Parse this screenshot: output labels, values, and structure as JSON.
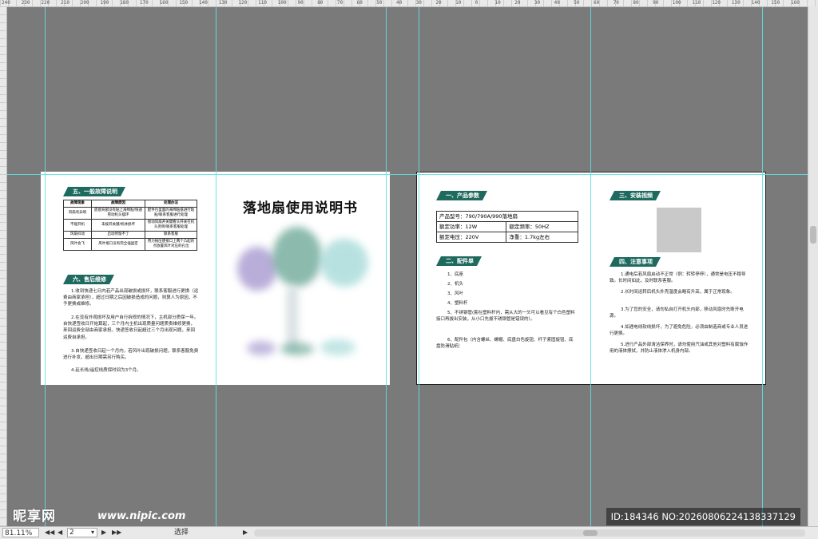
{
  "ruler": {
    "top_labels": [
      "240",
      "230",
      "220",
      "210",
      "200",
      "190",
      "180",
      "170",
      "160",
      "150",
      "140",
      "130",
      "120",
      "110",
      "100",
      "90",
      "80",
      "70",
      "60",
      "50",
      "40",
      "30",
      "20",
      "10",
      "0",
      "10",
      "20",
      "30",
      "40",
      "50",
      "60",
      "70",
      "80",
      "90",
      "100",
      "110",
      "120",
      "130",
      "140",
      "150",
      "160",
      "170",
      "180",
      "190",
      "200",
      "210",
      "220",
      "230",
      "240",
      "250",
      "260",
      "270",
      "280",
      "290",
      "300",
      "310",
      "320",
      "330",
      "340",
      "350",
      "360",
      "370",
      "380",
      "390",
      "400",
      "410",
      "420",
      "430",
      "440",
      "450"
    ]
  },
  "status": {
    "zoom": "81.11%",
    "page": "2",
    "tool": "选择"
  },
  "left_page": {
    "sec5_title": "五、一般故障说明",
    "fault_table": {
      "headers": [
        "故障现象",
        "故障原因",
        "处理办法"
      ],
      "rows": [
        [
          "风扇有异响",
          "底盘背部没有贴上海绵贴/快速晃动机头摆环",
          "配件包里面的海绵贴纸进行粘贴/联系客服进行处理"
        ],
        [
          "不能开机",
          "未按开关键/机体损坏",
          "接动风扇开关键看头开关在机头旁侧/联系客服处理"
        ],
        [
          "风扇抖动",
          "启动停留不了",
          "联系客服"
        ],
        [
          "风叶会飞",
          "风叶接口没有完全插固定",
          "用力按压使接口上两个凸起的点放置风叶对应的孔位"
        ]
      ]
    },
    "sec6_title": "六、售后维修",
    "sec6_paragraphs": [
      "1.收到快递七日内若产品出现破损或损坏，联系客服进行更换（运费由商家承担），超过日期之后因破损造成的问题，则算人为原因，不予更换或维修。",
      "2.在没有外观损坏及用户自行拆修的情况下，主机部分质保一年。自快递签收日开始算起，三个月内主机出现质量问题质责维修更换，来回运费全部由商家承担。快递签收日起超过三个月出现问题，来回运费自承担。",
      "3.自快递签收日起一个月内，若风叶出现破损问题，联系客服免费进行补发，超出日期需另行购买。",
      "4.延长线/遥控线质保时间为3个月。"
    ],
    "cover_title": "落地扇使用说明书"
  },
  "right_page": {
    "sec1_title": "一、产品参数",
    "params": {
      "model": "产品型号：790/790A/990落地扇",
      "power": "额定功率：12W",
      "freq": "额定频率：50HZ",
      "voltage": "额定电压：220V",
      "weight": "净重：1.7kg左右"
    },
    "sec2_title": "二、配件单",
    "parts": [
      "1、底座",
      "2、机头",
      "3、风叶",
      "4、塑料杆",
      "5、不锈钢管(套在塑料杆内，需从大的一头可以看见有个白色塑料接口再拔出安装，从小口先拔不锈钢管是错误的）。",
      "6、配件包（内含螺丝、螺帽、底盘白色旋钮、杆子紧固旋钮、底盘防滑贴纸）"
    ],
    "sec3_title": "三、安装视频",
    "sec4_title": "四、注意事项",
    "notes": [
      "1.通电后若风扇启动不正常（例：转转停停），通常是电压不稳导致。长时间如此，及时联系客服。",
      "2.长时间运转后机头外壳温度会略有升高，属于正常现象。",
      "3.为了您的安全，请勿私自打开机头内部，移动风扇时先断开电源。",
      "4.如遇电线软线损坏，为了避免危险，必须由制造商或专业人员进行更换。",
      "5.进行产品外部清洁保养时，请勿使用汽油或其他对塑料有腐蚀作用的液体擦拭，并防止液体渗入机身内部。"
    ]
  },
  "watermark": {
    "logo": "昵享网",
    "url": "www.nipic.com",
    "id": "ID:184346 NO:20260806224138337129"
  },
  "colors": {
    "accent": "#1f6a5f",
    "guide": "#5fe0e0",
    "background": "#7a7a7a"
  }
}
